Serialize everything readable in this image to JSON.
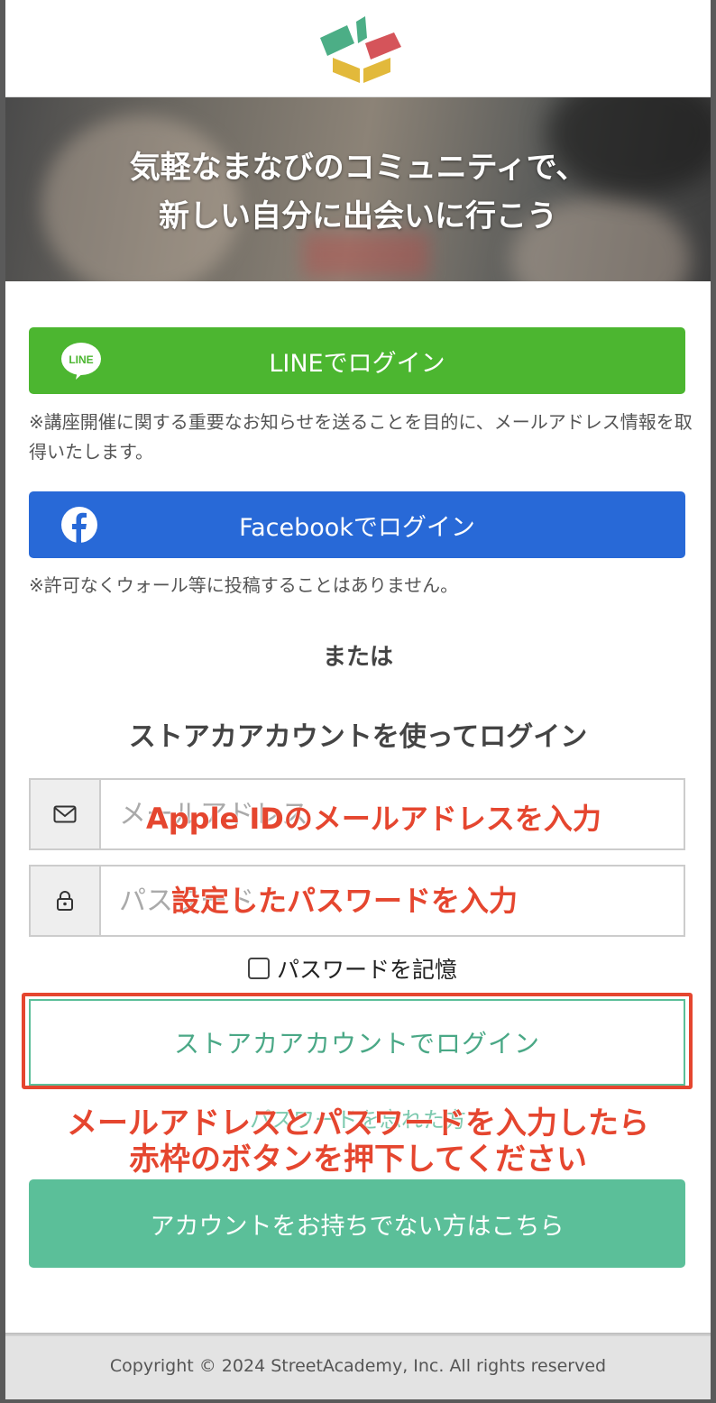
{
  "hero": {
    "line1": "気軽なまなびのコミュニティで、",
    "line2": "新しい自分に出会いに行こう"
  },
  "social": {
    "line_label": "LINEでログイン",
    "line_icon_text": "LINE",
    "line_note": "※講座開催に関する重要なお知らせを送ることを目的に、メールアドレス情報を取得いたします。",
    "facebook_label": "Facebookでログイン",
    "facebook_note": "※許可なくウォール等に投稿することはありません。"
  },
  "divider_text": "または",
  "store_login": {
    "title": "ストアカアカウントを使ってログイン",
    "email_placeholder": "メールアドレス",
    "password_placeholder": "パスワード",
    "remember_label": "パスワードを記憶",
    "submit_label": "ストアカアカウントでログイン",
    "forgot_label": "パスワードを忘れた方"
  },
  "annotations": {
    "email": "Apple IDのメールアドレスを入力",
    "password": "設定したパスワードを入力",
    "bottom_line1": "メールアドレスとパスワードを入力したら",
    "bottom_line2": "赤枠のボタンを押下してください"
  },
  "signup_label": "アカウントをお持ちでない方はこちら",
  "footer": {
    "copyright": "Copyright © 2024 StreetAcademy, Inc. All rights reserved"
  },
  "colors": {
    "line_green": "#4cb630",
    "facebook_blue": "#2869d7",
    "brand_green": "#5bbf99",
    "annotation_red": "#e5462f"
  }
}
